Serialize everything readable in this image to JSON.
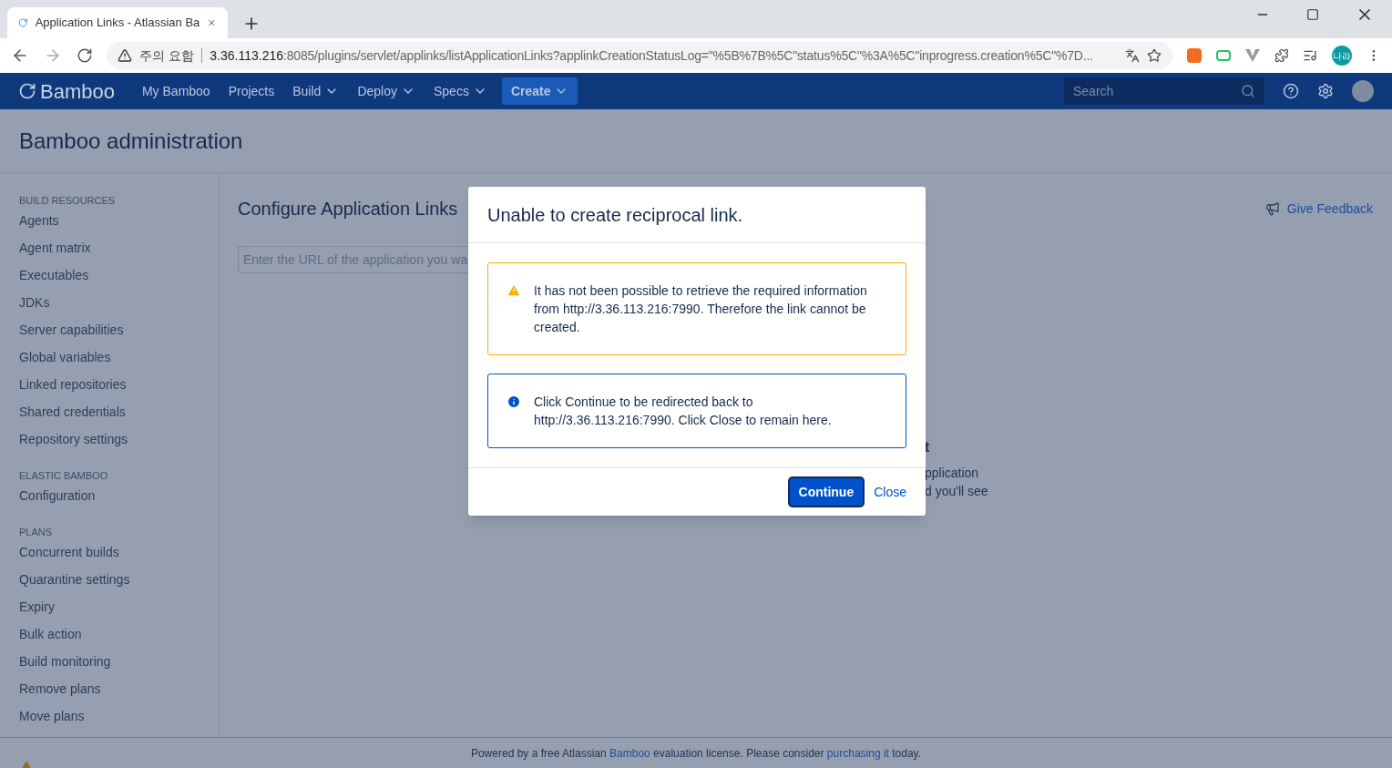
{
  "browser": {
    "tab_title": "Application Links - Atlassian Ba",
    "address_warning": "주의 요함",
    "url_host": "3.36.113.216",
    "url_rest": ":8085/plugins/servlet/applinks/listApplicationLinks?applinkCreationStatusLog=\"%5B%7B%5C\"status%5C\"%3A%5C\"inprogress.creation%5C\"%7D...",
    "profile": "나라"
  },
  "nav": {
    "logo": "Bamboo",
    "items": [
      {
        "label": "My Bamboo",
        "dropdown": false
      },
      {
        "label": "Projects",
        "dropdown": false
      },
      {
        "label": "Build",
        "dropdown": true
      },
      {
        "label": "Deploy",
        "dropdown": true
      },
      {
        "label": "Specs",
        "dropdown": true
      }
    ],
    "create": "Create",
    "search": {
      "placeholder": "Search"
    }
  },
  "page_title": "Bamboo administration",
  "sidebar": {
    "sections": [
      {
        "heading": "BUILD RESOURCES",
        "items": [
          "Agents",
          "Agent matrix",
          "Executables",
          "JDKs",
          "Server capabilities",
          "Global variables",
          "Linked repositories",
          "Shared credentials",
          "Repository settings"
        ]
      },
      {
        "heading": "ELASTIC BAMBOO",
        "items": [
          "Configuration"
        ]
      },
      {
        "heading": "PLANS",
        "items": [
          "Concurrent builds",
          "Quarantine settings",
          "Expiry",
          "Bulk action",
          "Build monitoring",
          "Remove plans",
          "Move plans"
        ]
      }
    ]
  },
  "main": {
    "title": "Configure Application Links",
    "url_field": {
      "placeholder": "Enter the URL of the application you wa"
    },
    "feedback": "Give Feedback",
    "behind_dialog": {
      "heading": "t",
      "lines": [
        "pplication",
        "d you'll see"
      ]
    }
  },
  "dialog": {
    "title": "Unable to create reciprocal link.",
    "messages": [
      {
        "kind": "warning",
        "text": "It has not been possible to retrieve the required information from http://3.36.113.216:7990. Therefore the link cannot be created."
      },
      {
        "kind": "info",
        "text": "Click Continue to be redirected back to http://3.36.113.216:7990. Click Close to remain here."
      }
    ],
    "primary": "Continue",
    "secondary": "Close"
  },
  "footer": [
    {
      "text": "Powered by a free Atlassian ",
      "link": false
    },
    {
      "text": "Bamboo",
      "link": true
    },
    {
      "text": " evaluation license. Please consider ",
      "link": false
    },
    {
      "text": "purchasing it",
      "link": true
    },
    {
      "text": " today.",
      "link": false
    }
  ]
}
